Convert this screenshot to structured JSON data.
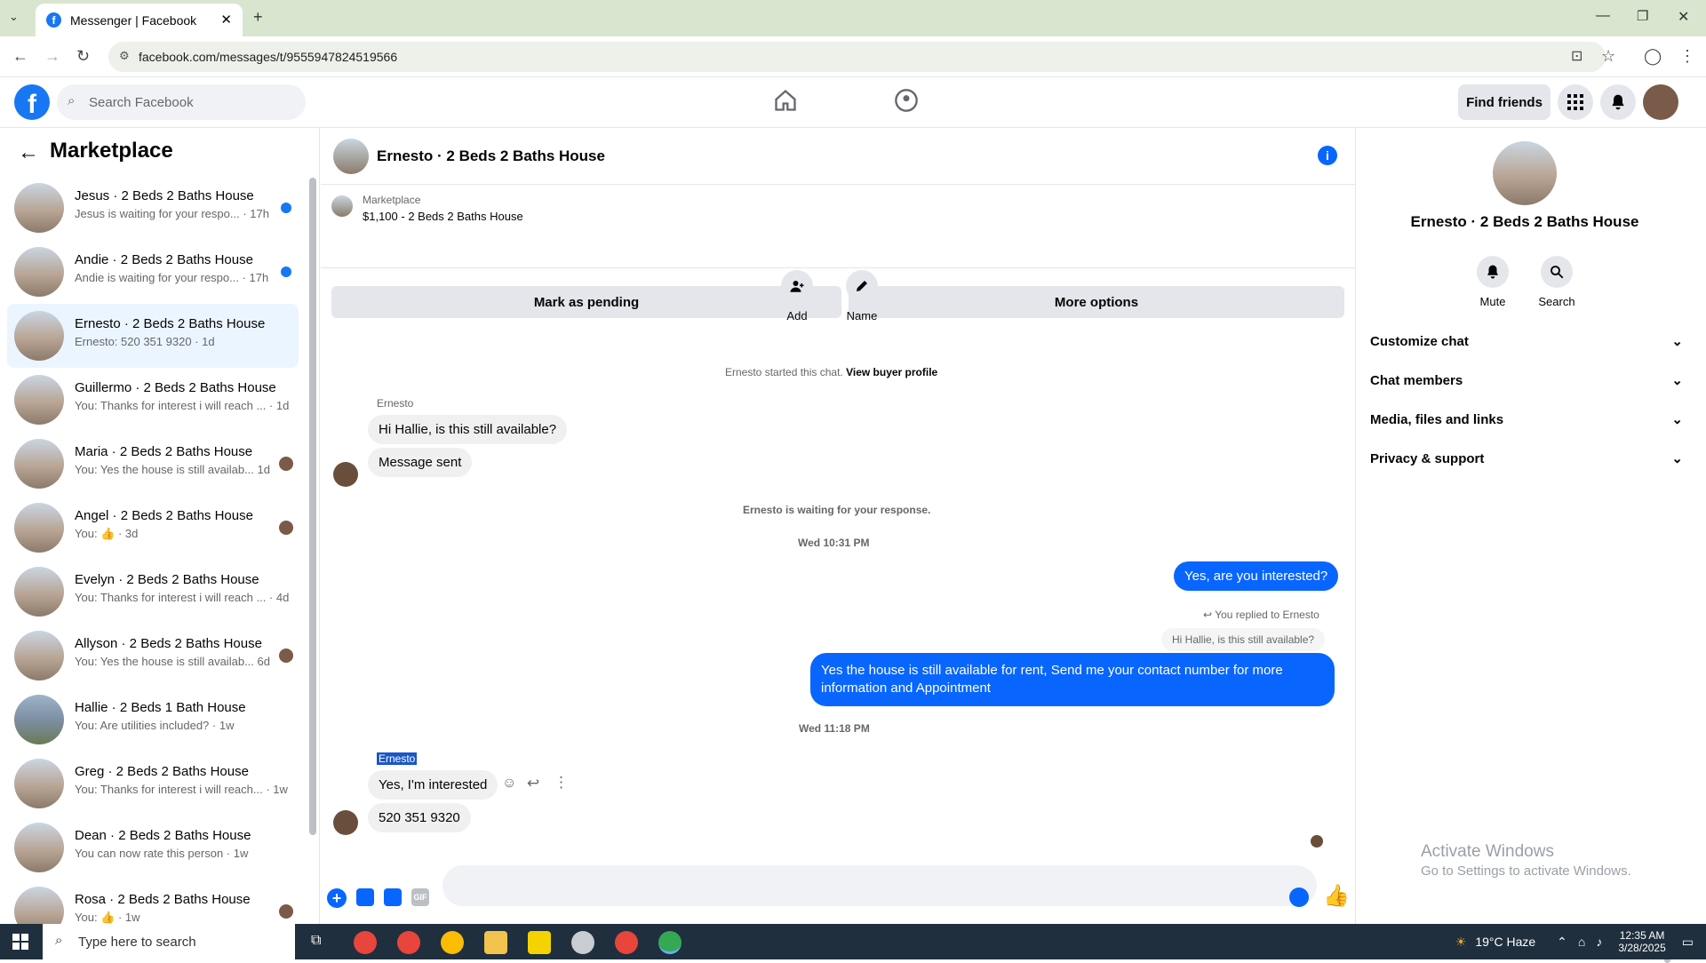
{
  "browser": {
    "tab_title": "Messenger | Facebook",
    "url": "facebook.com/messages/t/9555947824519566"
  },
  "fb_header": {
    "search_placeholder": "Search Facebook",
    "find_friends": "Find friends"
  },
  "sidebar": {
    "title": "Marketplace",
    "conversations": [
      {
        "name": "Jesus · 2 Beds 2 Baths House",
        "preview": "Jesus is waiting for your respo... · 17h"
      },
      {
        "name": "Andie · 2 Beds 2 Baths House",
        "preview": "Andie is waiting for your respo... · 17h"
      },
      {
        "name": "Ernesto · 2 Beds 2 Baths House",
        "preview": "Ernesto: 520 351 9320 · 1d"
      },
      {
        "name": "Guillermo · 2 Beds 2 Baths House",
        "preview": "You: Thanks for interest i will reach ... · 1d"
      },
      {
        "name": "Maria · 2 Beds 2 Baths House",
        "preview": "You: Yes the house is still availab... 1d"
      },
      {
        "name": "Angel · 2 Beds 2 Baths House",
        "preview": "You: 👍 · 3d"
      },
      {
        "name": "Evelyn · 2 Beds 2 Baths House",
        "preview": "You: Thanks for interest i will reach ... · 4d"
      },
      {
        "name": "Allyson · 2 Beds 2 Baths House",
        "preview": "You: Yes the house is still availab... 6d"
      },
      {
        "name": "Hallie · 2 Beds 1 Bath House",
        "preview": "You: Are utilities included? · 1w"
      },
      {
        "name": "Greg · 2 Beds 2 Baths House",
        "preview": "You: Thanks for interest i will reach... · 1w"
      },
      {
        "name": "Dean · 2 Beds 2 Baths House",
        "preview": "You can now rate this person · 1w"
      },
      {
        "name": "Rosa · 2 Beds 2 Baths House",
        "preview": "You: 👍 · 1w"
      }
    ]
  },
  "chat": {
    "title": "Ernesto · 2 Beds 2 Baths House",
    "marketplace_label": "Marketplace",
    "listing": "$1,100 - 2 Beds 2 Baths House",
    "mark_pending": "Mark as pending",
    "more_options": "More options",
    "add_label": "Add",
    "name_label": "Name",
    "started_text": "Ernesto started this chat.",
    "view_profile": "View buyer profile",
    "sender1": "Ernesto",
    "msg1": "Hi Hallie, is this still available?",
    "msg2": "Message sent",
    "waiting": "Ernesto is waiting for your response.",
    "time1": "Wed 10:31 PM",
    "out1": "Yes, are you interested?",
    "replied_to": "You replied to Ernesto",
    "quoted": "Hi Hallie, is this still available?",
    "out2": "Yes the house is still available for rent, Send me your contact number for more information and Appointment",
    "time2": "Wed 11:18 PM",
    "sender2": "Ernesto",
    "msg3": "Yes, I'm interested",
    "msg4": "520 351 9320"
  },
  "details": {
    "name": "Ernesto · 2 Beds 2 Baths House",
    "mute": "Mute",
    "search": "Search",
    "sections": [
      "Customize chat",
      "Chat members",
      "Media, files and links",
      "Privacy & support"
    ]
  },
  "watermark": {
    "line1": "Activate Windows",
    "line2": "Go to Settings to activate Windows."
  },
  "taskbar": {
    "search_placeholder": "Type here to search",
    "weather": "19°C  Haze",
    "time": "12:35 AM",
    "date": "3/28/2025"
  },
  "colors": {
    "brand": "#1877f2",
    "outgoing_bubble": "#0866ff"
  }
}
